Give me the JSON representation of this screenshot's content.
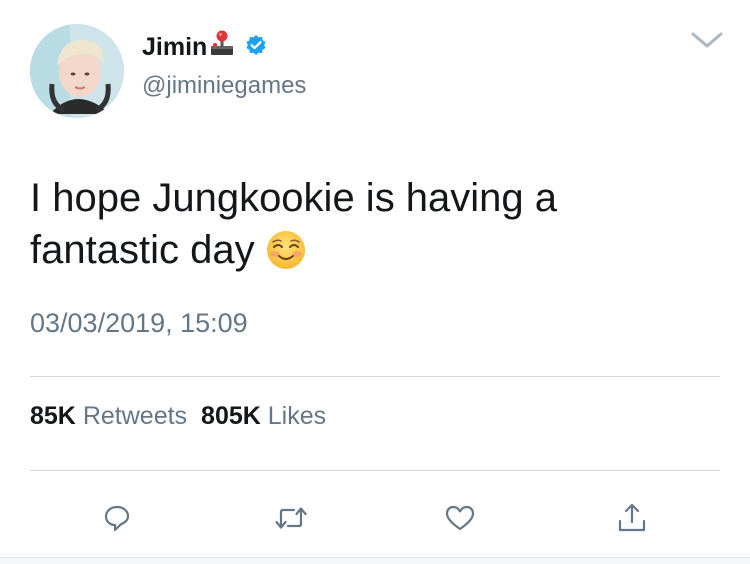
{
  "tweet": {
    "display_name": "Jimin",
    "name_emoji": "joystick-icon",
    "verified": true,
    "handle": "@jiminiegames",
    "text_lines": [
      "I hope Jungkookie is having a",
      "fantastic day"
    ],
    "text_emoji": "smiling-face-emoji",
    "timestamp": "03/03/2019, 15:09",
    "retweets_count": "85K",
    "retweets_label": "Retweets",
    "likes_count": "805K",
    "likes_label": "Likes"
  },
  "actions": [
    {
      "icon": "reply-icon"
    },
    {
      "icon": "retweet-icon"
    },
    {
      "icon": "like-icon"
    },
    {
      "icon": "share-icon"
    }
  ],
  "colors": {
    "text_primary": "#14171a",
    "text_secondary": "#657786",
    "verified_blue": "#1da1f2",
    "divider": "#d9d9d9"
  }
}
